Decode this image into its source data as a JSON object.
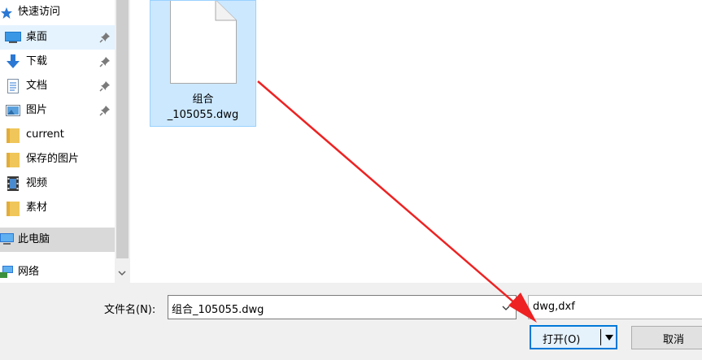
{
  "nav": {
    "items": [
      {
        "label": "快速访问",
        "icon": "star-icon"
      },
      {
        "label": "桌面",
        "icon": "desktop-icon",
        "pinned": true
      },
      {
        "label": "下载",
        "icon": "download-icon",
        "pinned": true
      },
      {
        "label": "文档",
        "icon": "document-icon",
        "pinned": true
      },
      {
        "label": "图片",
        "icon": "pictures-icon",
        "pinned": true
      },
      {
        "label": "current",
        "icon": "folder-icon"
      },
      {
        "label": "保存的图片",
        "icon": "folder-icon"
      },
      {
        "label": "视频",
        "icon": "video-icon"
      },
      {
        "label": "素材",
        "icon": "folder-icon"
      },
      {
        "label": "此电脑",
        "icon": "computer-icon"
      },
      {
        "label": "网络",
        "icon": "network-icon"
      }
    ]
  },
  "files": [
    {
      "name_line1": "组合",
      "name_line2": "_105055.dwg"
    }
  ],
  "bottom": {
    "filename_label": "文件名(N):",
    "filename_value": "组合_105055.dwg",
    "filter_value": "dwg,dxf",
    "open_label": "打开(O)",
    "cancel_label": "取消"
  },
  "colors": {
    "selection": "#cce8ff",
    "selection_border": "#99d1ff",
    "accent": "#0078d7",
    "annotation_arrow": "#ee2222"
  }
}
